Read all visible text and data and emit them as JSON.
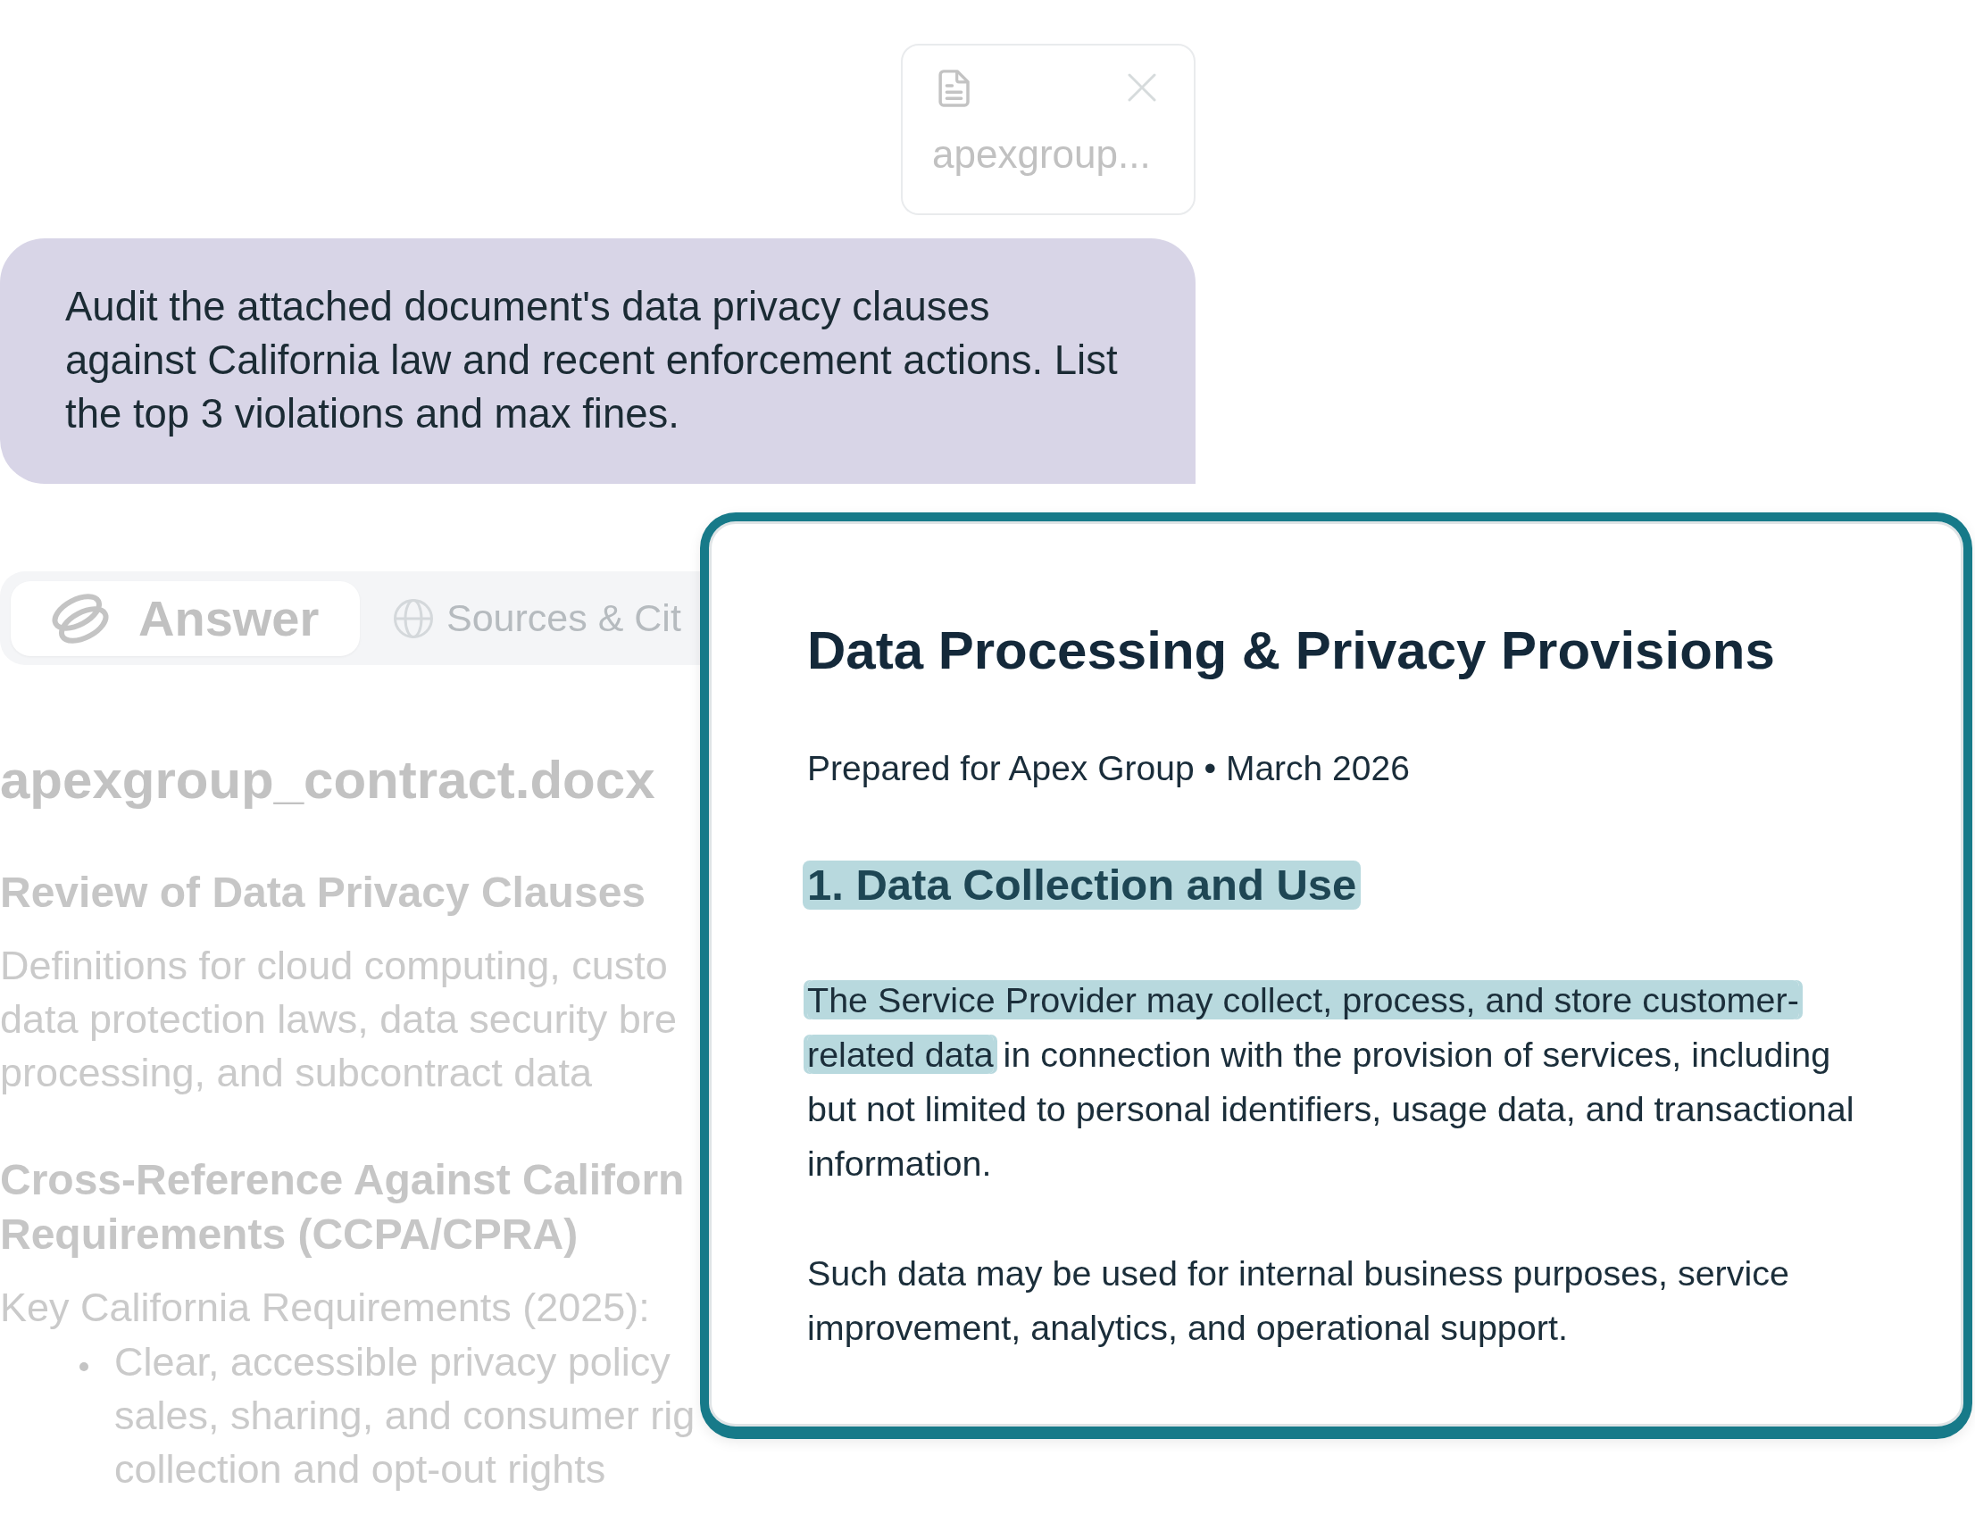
{
  "attachment": {
    "file_name": "apexgroup..."
  },
  "message": {
    "text": "Audit the attached document's data privacy clauses against California law and recent enforcement actions. List the top 3 violations and max fines."
  },
  "tabs": [
    {
      "label": "Answer",
      "kind": "logo",
      "selected": true
    },
    {
      "label": "Sources & Cit",
      "kind": "globe",
      "selected": false
    }
  ],
  "answer": {
    "title": "apexgroup_contract.docx",
    "blocks": [
      {
        "kind": "heading",
        "lines": [
          "Review of Data Privacy Clauses"
        ]
      },
      {
        "kind": "paragraph",
        "lines": [
          "Definitions for cloud computing, custo",
          "data protection laws, data security bre",
          "processing, and subcontract data"
        ]
      },
      {
        "kind": "heading",
        "lines": [
          "Cross-Reference Against Californ",
          "Requirements (CCPA/CPRA)"
        ]
      },
      {
        "kind": "paragraph",
        "lines": [
          "Key California Requirements (2025):"
        ]
      },
      {
        "kind": "bullet",
        "lines": [
          "Clear, accessible privacy policy",
          "sales, sharing, and consumer rig",
          "collection and opt-out rights"
        ]
      }
    ]
  },
  "document_preview": {
    "title": "Data Processing & Privacy Provisions",
    "subtitle": "Prepared for Apex Group • March 2026",
    "heading": {
      "text": "1. Data Collection and Use",
      "highlighted": true
    },
    "paragraphs": [
      {
        "segments": [
          {
            "text": "The Service Provider may collect, process, and store customer-related data",
            "highlighted": true
          },
          {
            "text": " in connection with the provision of services, including but not limited to personal identifiers, usage data, and transactional information.",
            "highlighted": false
          }
        ]
      },
      {
        "segments": [
          {
            "text": "Such data may be used for internal business purposes, service improvement, analytics, and operational support.",
            "highlighted": false
          }
        ]
      }
    ]
  }
}
